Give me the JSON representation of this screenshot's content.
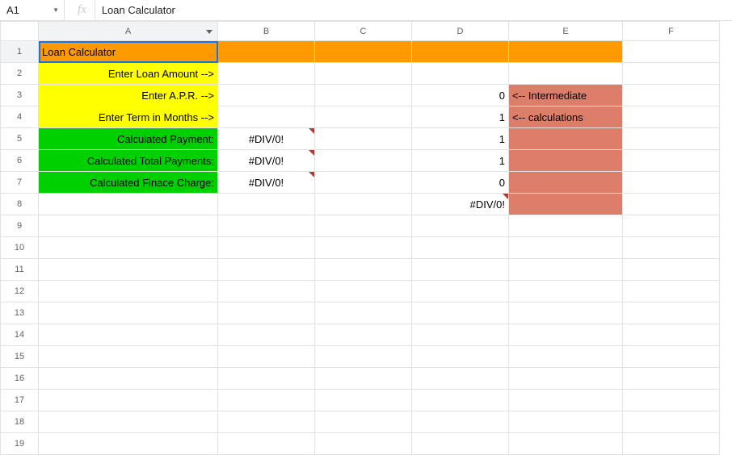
{
  "nameBox": "A1",
  "fxLabel": "fx",
  "formula": "Loan Calculator",
  "columns": [
    "A",
    "B",
    "C",
    "D",
    "E",
    "F"
  ],
  "rowCount": 19,
  "activeCell": {
    "row": 1,
    "col": "A"
  },
  "colors": {
    "orange": "#ff9900",
    "yellow": "#ffff00",
    "green": "#00d000",
    "red": "#dd7e6b"
  },
  "cells": {
    "A1": {
      "v": "Loan Calculator",
      "bg": "orange",
      "align": "left"
    },
    "B1": {
      "v": "",
      "bg": "orange"
    },
    "C1": {
      "v": "",
      "bg": "orange"
    },
    "D1": {
      "v": "",
      "bg": "orange"
    },
    "E1": {
      "v": "",
      "bg": "orange"
    },
    "A2": {
      "v": "Enter Loan Amount -->",
      "bg": "yellow",
      "align": "right"
    },
    "A3": {
      "v": "Enter A.P.R. -->",
      "bg": "yellow",
      "align": "right"
    },
    "A4": {
      "v": "Enter Term in Months -->",
      "bg": "yellow",
      "align": "right"
    },
    "A5": {
      "v": "Calculated Payment:",
      "bg": "green",
      "align": "right"
    },
    "A6": {
      "v": "Calculated Total Payments:",
      "bg": "green",
      "align": "right"
    },
    "A7": {
      "v": "Calculated Finace Charge:",
      "bg": "green",
      "align": "right"
    },
    "B5": {
      "v": "#DIV/0!",
      "align": "center",
      "marker": true
    },
    "B6": {
      "v": "#DIV/0!",
      "align": "center",
      "marker": true
    },
    "B7": {
      "v": "#DIV/0!",
      "align": "center",
      "marker": true
    },
    "D3": {
      "v": "0",
      "align": "right"
    },
    "D4": {
      "v": "1",
      "align": "right"
    },
    "D5": {
      "v": "1",
      "align": "right"
    },
    "D6": {
      "v": "1",
      "align": "right"
    },
    "D7": {
      "v": "0",
      "align": "right"
    },
    "D8": {
      "v": "#DIV/0!",
      "align": "right",
      "marker": true
    },
    "E3": {
      "v": "<-- Intermediate",
      "bg": "red",
      "align": "left"
    },
    "E4": {
      "v": "<-- calculations",
      "bg": "red",
      "align": "left"
    },
    "E5": {
      "v": "",
      "bg": "red"
    },
    "E6": {
      "v": "",
      "bg": "red"
    },
    "E7": {
      "v": "",
      "bg": "red"
    },
    "E8": {
      "v": "",
      "bg": "red"
    }
  }
}
